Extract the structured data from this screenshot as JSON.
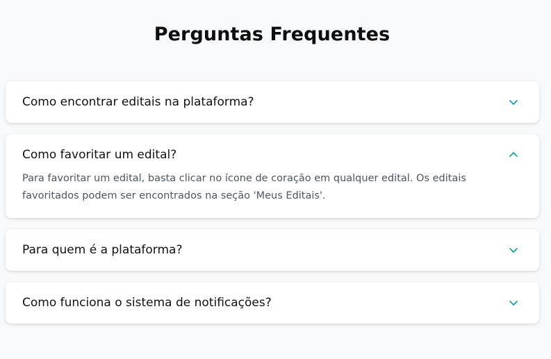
{
  "page": {
    "title": "Perguntas Frequentes"
  },
  "colors": {
    "accent": "#0ea5b7",
    "background": "#f8f9fb",
    "card": "#ffffff"
  },
  "faq": [
    {
      "question": "Como encontrar editais na plataforma?",
      "expanded": false,
      "icon": "chevron-down-icon"
    },
    {
      "question": "Como favoritar um edital?",
      "expanded": true,
      "icon": "chevron-up-icon",
      "answer": "Para favoritar um edital, basta clicar no ícone de coração em qualquer edital. Os editais favoritados podem ser encontrados na seção 'Meus Editais'."
    },
    {
      "question": "Para quem é a plataforma?",
      "expanded": false,
      "icon": "chevron-down-icon"
    },
    {
      "question": "Como funciona o sistema de notificações?",
      "expanded": false,
      "icon": "chevron-down-icon"
    }
  ]
}
